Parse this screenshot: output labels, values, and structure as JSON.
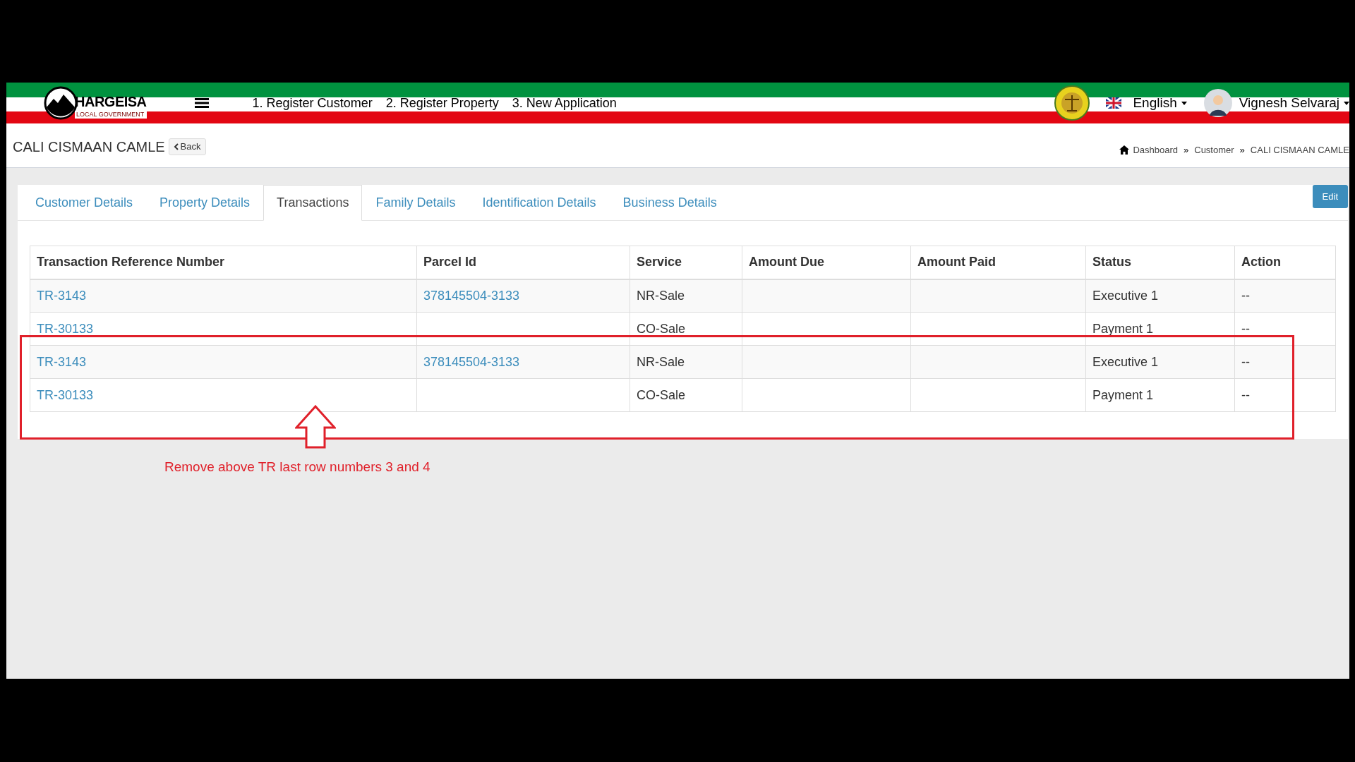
{
  "header": {
    "logo": {
      "title": "HARGEISA",
      "subtitle": "LOCAL GOVERNMENT"
    },
    "nav_links": [
      "1. Register Customer",
      "2. Register Property",
      "3. New Application"
    ],
    "language": "English",
    "user": "Vignesh Selvaraj"
  },
  "page_title": "CALI CISMAAN CAMLE",
  "back_button": "Back",
  "breadcrumb": {
    "separator": "»",
    "items": [
      "Dashboard",
      "Customer",
      "CALI CISMAAN CAMLE"
    ]
  },
  "tabs": [
    {
      "label": "Customer Details",
      "selected": false
    },
    {
      "label": "Property Details",
      "selected": false
    },
    {
      "label": "Transactions",
      "selected": true
    },
    {
      "label": "Family Details",
      "selected": false
    },
    {
      "label": "Identification Details",
      "selected": false
    },
    {
      "label": "Business Details",
      "selected": false
    }
  ],
  "edit_button": "Edit",
  "table": {
    "columns": [
      "Transaction Reference Number",
      "Parcel Id",
      "Service",
      "Amount Due",
      "Amount Paid",
      "Status",
      "Action"
    ],
    "rows": [
      [
        {
          "text": "TR-3143",
          "kind": "link"
        },
        {
          "text": "378145504-3133",
          "kind": "link"
        },
        {
          "text": "NR-Sale",
          "kind": "text"
        },
        null,
        null,
        {
          "text": "Executive 1",
          "kind": "text"
        },
        {
          "text": "--",
          "kind": "text"
        }
      ],
      [
        {
          "text": "TR-30133",
          "kind": "link"
        },
        null,
        {
          "text": "CO-Sale",
          "kind": "text"
        },
        null,
        null,
        {
          "text": "Payment 1",
          "kind": "text"
        },
        {
          "text": "--",
          "kind": "text"
        }
      ],
      [
        {
          "text": "TR-3143",
          "kind": "link"
        },
        {
          "text": "378145504-3133",
          "kind": "link"
        },
        {
          "text": "NR-Sale",
          "kind": "text"
        },
        null,
        null,
        {
          "text": "Executive 1",
          "kind": "text"
        },
        {
          "text": "--",
          "kind": "text"
        }
      ],
      [
        {
          "text": "TR-30133",
          "kind": "link"
        },
        null,
        {
          "text": "CO-Sale",
          "kind": "text"
        },
        null,
        null,
        {
          "text": "Payment 1",
          "kind": "text"
        },
        {
          "text": "--",
          "kind": "text"
        }
      ]
    ]
  },
  "annotation": "Remove above TR last row numbers 3 and 4"
}
